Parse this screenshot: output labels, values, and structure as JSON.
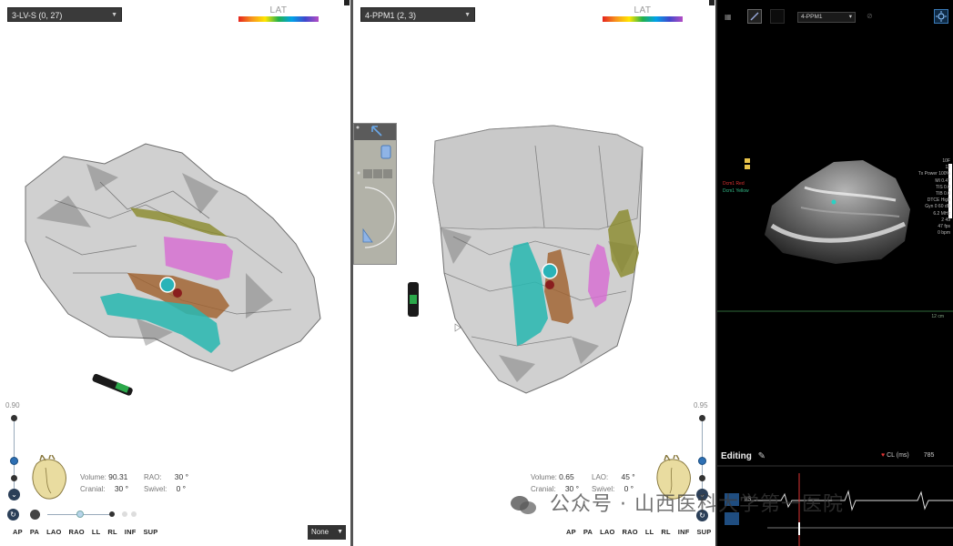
{
  "left_view": {
    "map_selector": "3-LV-S (0, 27)",
    "lat_label": "LAT",
    "slider_value": "0.90",
    "volume_label": "Volume:",
    "volume_value": "90.31",
    "rao_label": "RAO:",
    "rao_value": "30 °",
    "cranial_label": "Cranial:",
    "cranial_value": "30 °",
    "swivel_label": "Swivel:",
    "swivel_value": "0 °",
    "view_buttons": [
      "AP",
      "PA",
      "LAO",
      "RAO",
      "LL",
      "RL",
      "INF",
      "SUP"
    ],
    "bottom_select": "None"
  },
  "middle_view": {
    "map_selector": "4-PPM1 (2, 3)",
    "lat_label": "LAT",
    "slider_value": "0.95",
    "volume_label": "Volume:",
    "volume_value": "0.65",
    "lao_label": "LAO:",
    "lao_value": "45 °",
    "cranial_label": "Cranial:",
    "cranial_value": "30 °",
    "swivel_label": "Swivel:",
    "swivel_value": "0 °",
    "view_buttons": [
      "AP",
      "PA",
      "LAO",
      "RAO",
      "LL",
      "RL",
      "INF",
      "SUP"
    ]
  },
  "ultrasound": {
    "toolbar_select": "4-PPM1",
    "mode_label": "Editing",
    "cl_label": "CL (ms)",
    "cl_value": "785",
    "params": [
      "10F",
      "12",
      "Tx Power 100%",
      "MI 0.47",
      "TIS 0.0",
      "TIB 0.0",
      "DTCE High",
      "Gyn 0 60 dB",
      "6.2 MHz",
      "2 49",
      "47 fps",
      "0 bpm"
    ],
    "depth_label": "12 cm",
    "legend": [
      "Dcm1 Red",
      "Dcm1 Yellow"
    ],
    "ecg_label": "I/S"
  },
  "watermark": "公众号 · 山西医科大学第一医院",
  "colors": {
    "shell": "#a9a9a9",
    "teal_structure": "#2bb7b0",
    "magenta_structure": "#d76cd2",
    "olive_structure": "#8a8a2a",
    "brown_structure": "#a0612e",
    "catheter_tip": "#2ab3b8",
    "electrode": "#2ba84a"
  }
}
